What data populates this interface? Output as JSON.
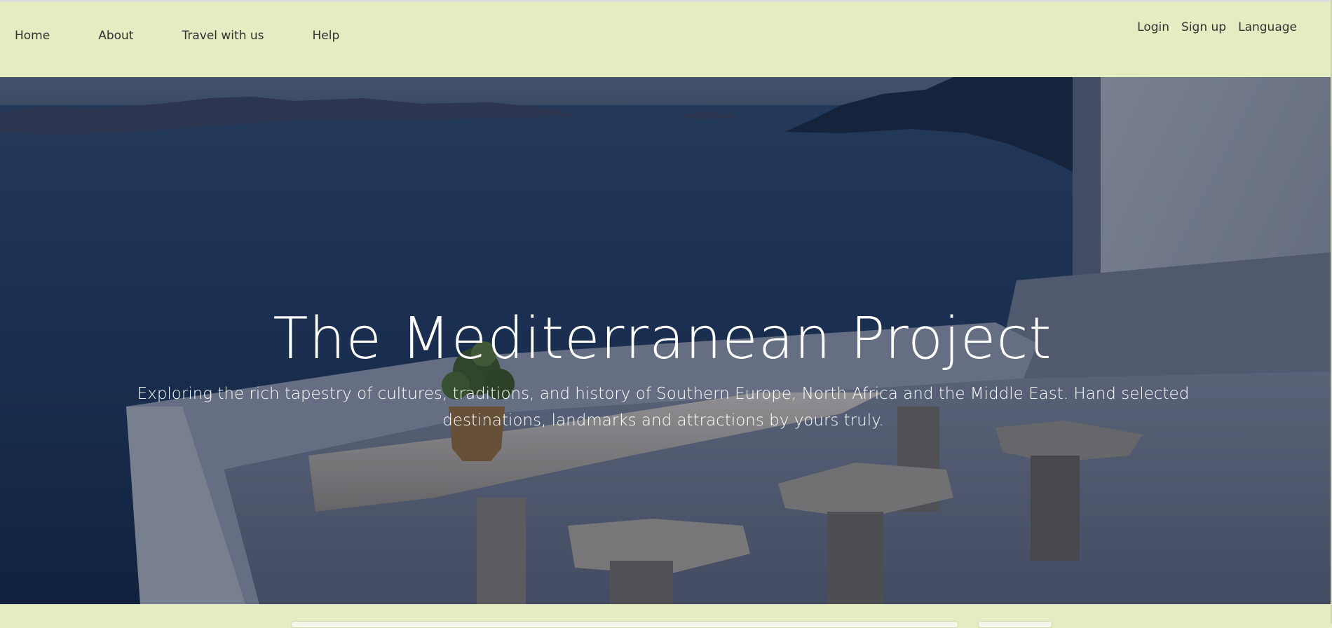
{
  "nav": {
    "left": [
      {
        "label": "Home"
      },
      {
        "label": "About"
      },
      {
        "label": "Travel with us"
      },
      {
        "label": "Help"
      }
    ],
    "right": [
      {
        "label": "Login"
      },
      {
        "label": "Sign up"
      },
      {
        "label": "Language"
      }
    ]
  },
  "hero": {
    "title": "The Mediterranean Project",
    "subtitle": "Exploring the rich tapestry of cultures, traditions, and history of Southern Europe, North Africa and the Middle East. Hand selected destinations, landmarks and attractions by yours truly."
  },
  "colors": {
    "nav_background": "#e4edc2",
    "nav_text": "#333333",
    "hero_text": "#ffffff"
  }
}
